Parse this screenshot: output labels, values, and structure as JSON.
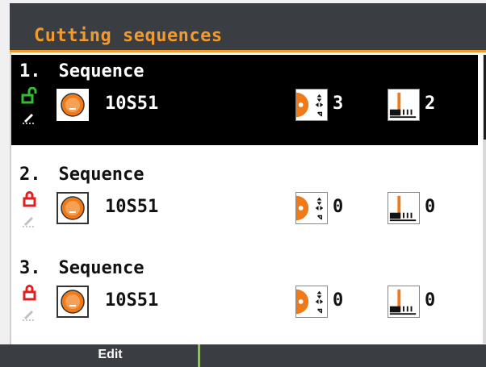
{
  "header": {
    "title": "Cutting sequences"
  },
  "sequences": [
    {
      "index": "1.",
      "name": "Sequence",
      "material": "10S51",
      "value_a": "3",
      "value_b": "2",
      "locked": false,
      "selected": true
    },
    {
      "index": "2.",
      "name": "Sequence",
      "material": "10S51",
      "value_a": "0",
      "value_b": "0",
      "locked": true,
      "selected": false
    },
    {
      "index": "3.",
      "name": "Sequence",
      "material": "10S51",
      "value_a": "0",
      "value_b": "0",
      "locked": true,
      "selected": false
    }
  ],
  "footer": {
    "edit_label": "Edit"
  },
  "colors": {
    "accent": "#f39a2e",
    "unlock": "#2fbf2f",
    "lock": "#e02020",
    "header": "#3a3d41",
    "selected_bg": "#000000"
  },
  "icons": {
    "unlock": "unlock-icon",
    "lock": "lock-icon",
    "pencil": "pencil-icon",
    "disc": "saw-disc-icon",
    "distribution": "sequence-position-icon",
    "bar": "bar-level-icon"
  }
}
